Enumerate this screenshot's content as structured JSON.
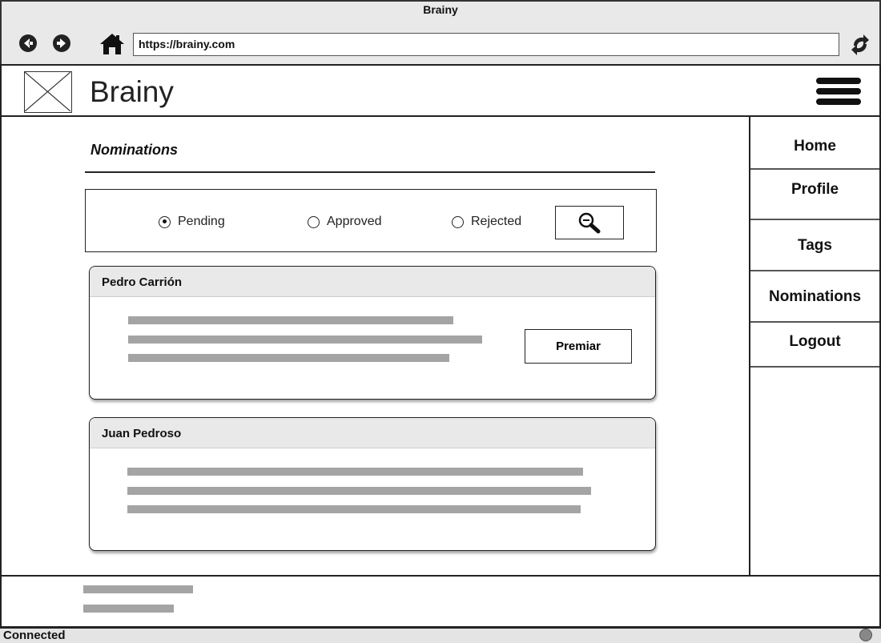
{
  "window": {
    "title": "Brainy"
  },
  "browser": {
    "url": "https://brainy.com",
    "icons": [
      "back-icon",
      "forward-icon",
      "home-icon",
      "refresh-icon"
    ]
  },
  "header": {
    "brand": "Brainy",
    "icons": [
      "image-placeholder-icon",
      "hamburger-menu-icon"
    ]
  },
  "sidebar": {
    "items": [
      {
        "label": "Home"
      },
      {
        "label": "Profile"
      },
      {
        "label": "Tags"
      },
      {
        "label": "Nominations"
      },
      {
        "label": "Logout"
      }
    ]
  },
  "main": {
    "title": "Nominations",
    "filters": [
      {
        "label": "Pending",
        "selected": true
      },
      {
        "label": "Approved",
        "selected": false
      },
      {
        "label": "Rejected",
        "selected": false
      }
    ],
    "search_icon": "zoom-search-icon",
    "nominations": [
      {
        "name": "Pedro Carrión",
        "action_label": "Premiar"
      },
      {
        "name": "Juan Pedroso"
      }
    ]
  },
  "status": {
    "text": "Connected",
    "icon": "globe-icon"
  },
  "colors": {
    "chrome": "#e9e9e9",
    "border": "#222222",
    "placeholder_text": "#a4a4a4",
    "card_header": "#e9e9e9"
  }
}
